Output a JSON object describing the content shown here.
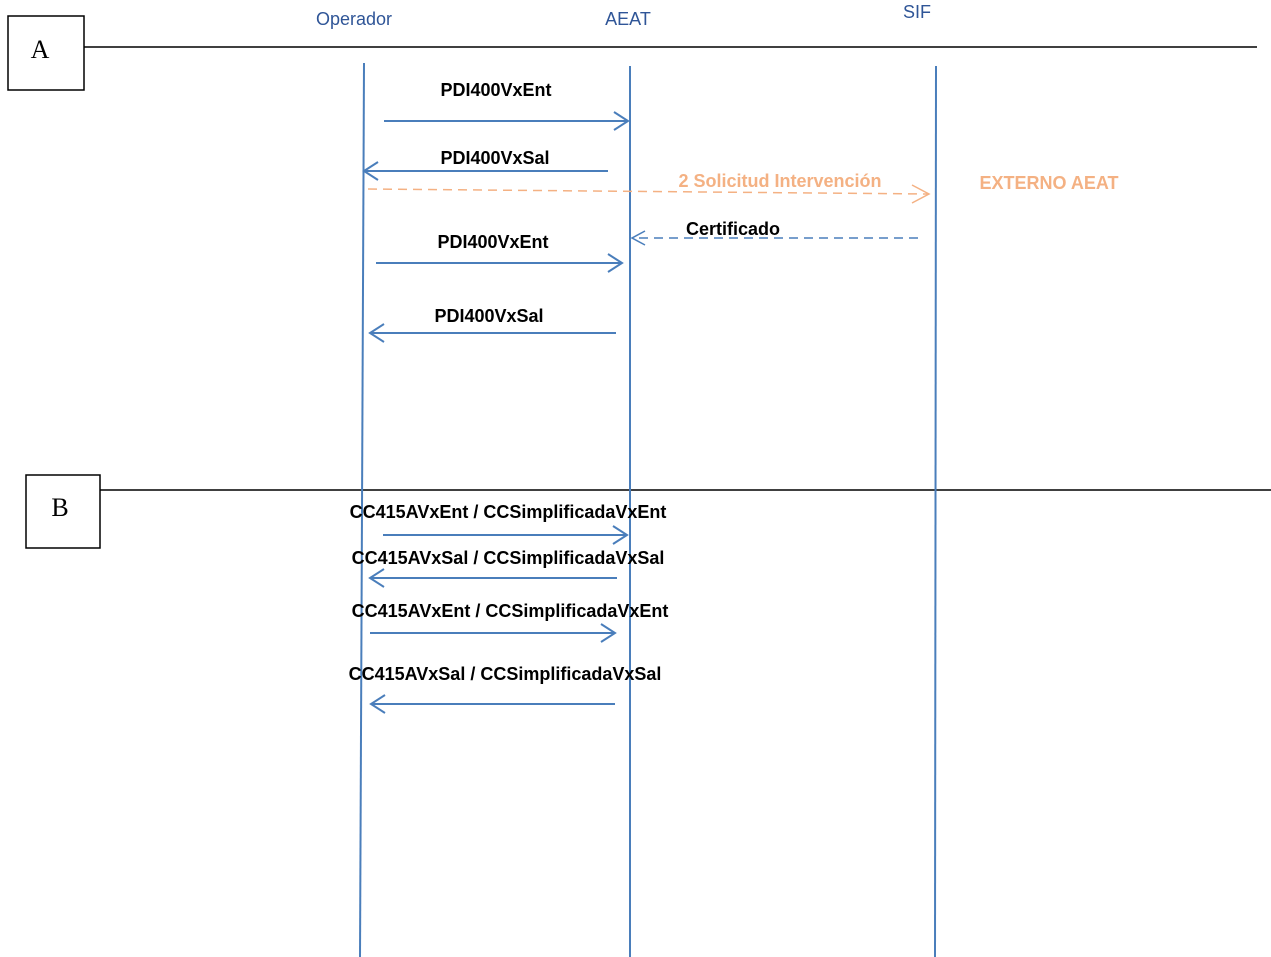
{
  "participants": {
    "operador": "Operador",
    "aeat": "AEAT",
    "sif": "SIF"
  },
  "sections": {
    "a": "A",
    "b": "B"
  },
  "messages": {
    "m1": "PDI400VxEnt",
    "m2": "PDI400VxSal",
    "m3": "2 Solicitud Intervención",
    "m3_target_note": "EXTERNO AEAT",
    "m4": "Certificado",
    "m5": "PDI400VxEnt",
    "m6": "PDI400VxSal",
    "m7": "CC415AVxEnt / CCSimplificadaVxEnt",
    "m8": "CC415AVxSal / CCSimplificadaVxSal",
    "m9": "CC415AVxEnt / CCSimplificadaVxEnt",
    "m10": "CC415AVxSal / CCSimplificadaVxSal"
  },
  "colors": {
    "lifeline": "#4a7ebb",
    "participant_text": "#2f5597",
    "external": "#f4b183"
  }
}
